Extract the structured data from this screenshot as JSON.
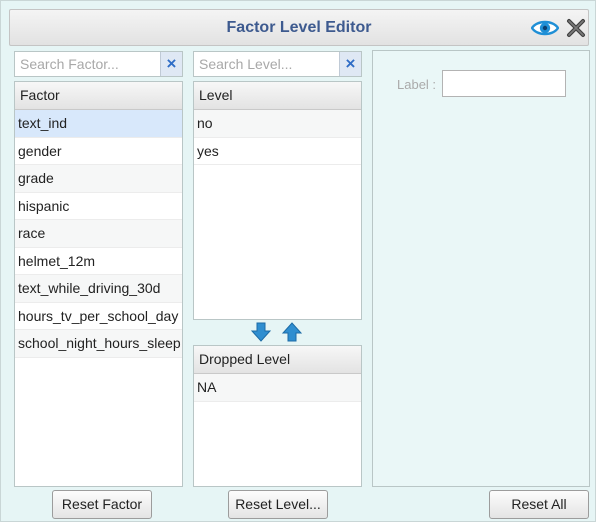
{
  "dialog": {
    "title": "Factor Level Editor",
    "icons": {
      "preview": "eye-icon",
      "close": "close-x-icon"
    }
  },
  "factor_panel": {
    "search_placeholder": "Search Factor...",
    "clear_label": "×",
    "header": "Factor",
    "selected_index": 0,
    "items": [
      "text_ind",
      "gender",
      "grade",
      "hispanic",
      "race",
      "helmet_12m",
      "text_while_driving_30d",
      "hours_tv_per_school_day",
      "school_night_hours_sleep"
    ]
  },
  "level_panel": {
    "search_placeholder": "Search Level...",
    "clear_label": "×",
    "header": "Level",
    "items": [
      "no",
      "yes"
    ]
  },
  "dropped_panel": {
    "header": "Dropped Level",
    "items": [
      "NA"
    ]
  },
  "move_arrows": {
    "down": "arrow-down-icon",
    "up": "arrow-up-icon"
  },
  "detail_panel": {
    "label_caption": "Label :",
    "label_value": ""
  },
  "buttons": {
    "reset_factor": "Reset Factor",
    "reset_level": "Reset Level...",
    "reset_all": "Reset All"
  },
  "colors": {
    "background": "#e6f5f5",
    "title_text": "#3d5a8f",
    "accent_blue": "#2f8ed0",
    "selected_row": "#d8e8fb"
  }
}
